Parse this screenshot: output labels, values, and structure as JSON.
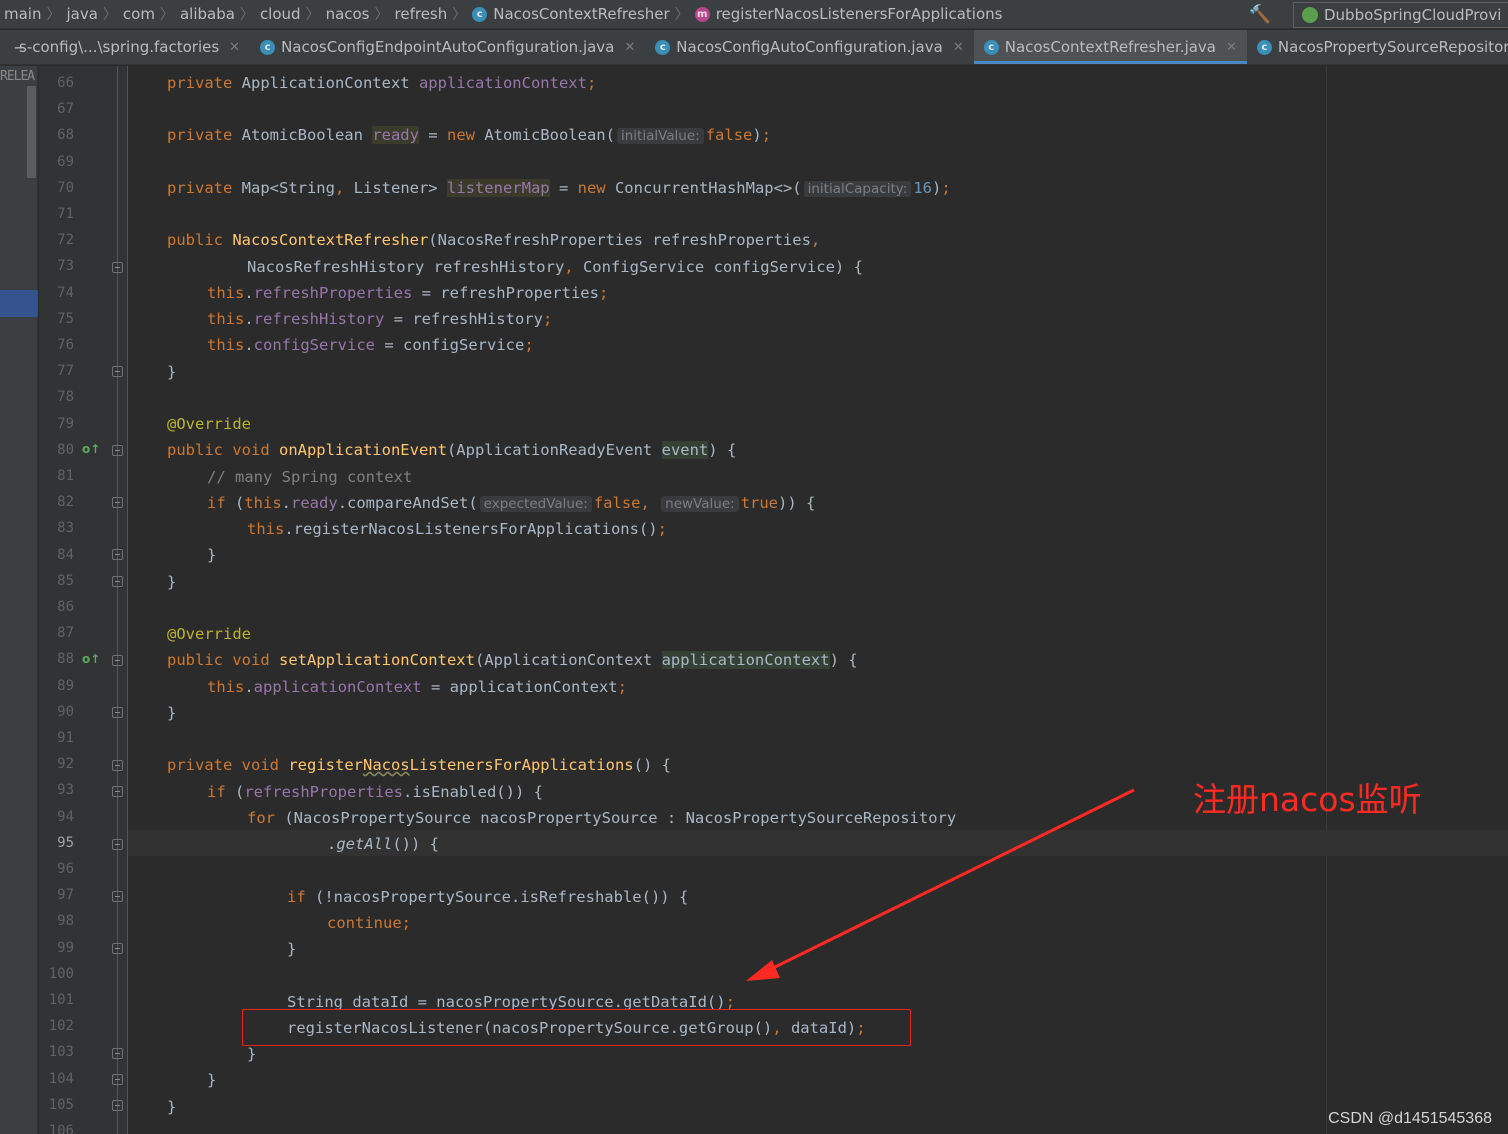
{
  "breadcrumb": {
    "items": [
      "main",
      "java",
      "com",
      "alibaba",
      "cloud",
      "nacos",
      "refresh"
    ],
    "class_item": "NacosContextRefresher",
    "method_item": "registerNacosListenersForApplications"
  },
  "run_config": {
    "label": "DubboSpringCloudProvi"
  },
  "tabs": [
    {
      "label": "s-config\\...\\spring.factories",
      "active": false
    },
    {
      "label": "NacosConfigEndpointAutoConfiguration.java",
      "active": false
    },
    {
      "label": "NacosConfigAutoConfiguration.java",
      "active": false
    },
    {
      "label": "NacosContextRefresher.java",
      "active": true
    },
    {
      "label": "NacosPropertySourceRepositor",
      "active": false
    }
  ],
  "toolstrip": {
    "label": "RELEA"
  },
  "editor": {
    "current_line": 95,
    "hints": {
      "initial_value": "initialValue:",
      "initial_capacity": "initialCapacity:",
      "expected_value": "expectedValue:",
      "new_value": "newValue:"
    },
    "lines": [
      {
        "n": "66",
        "text": "private ApplicationContext applicationContext;"
      },
      {
        "n": "67",
        "text": ""
      },
      {
        "n": "68",
        "text": "private AtomicBoolean ready = new AtomicBoolean( initialValue: false);"
      },
      {
        "n": "69",
        "text": ""
      },
      {
        "n": "70",
        "text": "private Map<String, Listener> listenerMap = new ConcurrentHashMap<>( initialCapacity: 16);"
      },
      {
        "n": "71",
        "text": ""
      },
      {
        "n": "72",
        "text": "public NacosContextRefresher(NacosRefreshProperties refreshProperties,"
      },
      {
        "n": "73",
        "text": "NacosRefreshHistory refreshHistory, ConfigService configService) {"
      },
      {
        "n": "74",
        "text": "this.refreshProperties = refreshProperties;"
      },
      {
        "n": "75",
        "text": "this.refreshHistory = refreshHistory;"
      },
      {
        "n": "76",
        "text": "this.configService = configService;"
      },
      {
        "n": "77",
        "text": "}"
      },
      {
        "n": "78",
        "text": ""
      },
      {
        "n": "79",
        "text": "@Override"
      },
      {
        "n": "80",
        "text": "public void onApplicationEvent(ApplicationReadyEvent event) {"
      },
      {
        "n": "81",
        "text": "// many Spring context"
      },
      {
        "n": "82",
        "text": "if (this.ready.compareAndSet( expectedValue: false, newValue: true)) {"
      },
      {
        "n": "83",
        "text": "this.registerNacosListenersForApplications();"
      },
      {
        "n": "84",
        "text": "}"
      },
      {
        "n": "85",
        "text": "}"
      },
      {
        "n": "86",
        "text": ""
      },
      {
        "n": "87",
        "text": "@Override"
      },
      {
        "n": "88",
        "text": "public void setApplicationContext(ApplicationContext applicationContext) {"
      },
      {
        "n": "89",
        "text": "this.applicationContext = applicationContext;"
      },
      {
        "n": "90",
        "text": "}"
      },
      {
        "n": "91",
        "text": ""
      },
      {
        "n": "92",
        "text": "private void registerNacosListenersForApplications() {"
      },
      {
        "n": "93",
        "text": "if (refreshProperties.isEnabled()) {"
      },
      {
        "n": "94",
        "text": "for (NacosPropertySource nacosPropertySource : NacosPropertySourceRepository"
      },
      {
        "n": "95",
        "text": ".getAll()) {"
      },
      {
        "n": "96",
        "text": ""
      },
      {
        "n": "97",
        "text": "if (!nacosPropertySource.isRefreshable()) {"
      },
      {
        "n": "98",
        "text": "continue;"
      },
      {
        "n": "99",
        "text": "}"
      },
      {
        "n": "100",
        "text": ""
      },
      {
        "n": "101",
        "text": "String dataId = nacosPropertySource.getDataId();"
      },
      {
        "n": "102",
        "text": "registerNacosListener(nacosPropertySource.getGroup(), dataId);"
      },
      {
        "n": "103",
        "text": "}"
      },
      {
        "n": "104",
        "text": "}"
      },
      {
        "n": "105",
        "text": "}"
      },
      {
        "n": "106",
        "text": ""
      }
    ]
  },
  "annotation": {
    "text": "注册nacos监听",
    "color": "#ff2a22"
  },
  "watermark": "CSDN @d1451545368",
  "colors": {
    "keyword": "#cc7832",
    "field": "#9876aa",
    "method_decl": "#ffc66d",
    "annotation": "#bbb529",
    "number": "#6897bb",
    "comment": "#808080"
  }
}
